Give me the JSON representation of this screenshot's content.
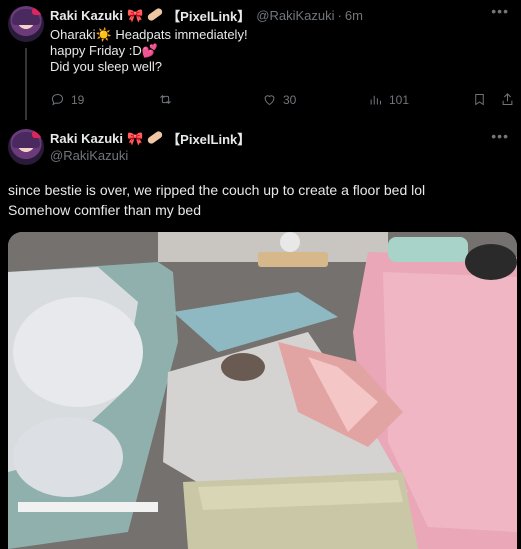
{
  "reply_tweet": {
    "display_name": "Raki Kazuki",
    "name_emojis": [
      "🎀",
      "🩹"
    ],
    "bracket_name": "【PixelLink】",
    "handle": "@RakiKazuki",
    "time": "6m",
    "lines": [
      "Oharaki",
      " Headpats immediately!",
      "happy Friday :D",
      "Did you sleep well?"
    ],
    "line1_emoji": "☀️",
    "line2_emoji": "💕",
    "actions": {
      "replies": "19",
      "reposts": "",
      "likes": "30",
      "views": "101"
    }
  },
  "main_tweet": {
    "display_name": "Raki Kazuki",
    "bracket_name": "【PixelLink】",
    "handle": "@RakiKazuki",
    "text_lines": [
      "since bestie is over, we ripped the couch up to create a floor bed lol",
      "Somehow comfier than my bed"
    ],
    "photo_alt": "Bedroom photo with a makeshift floor bed between two beds"
  },
  "colors": {
    "background": "#000000",
    "text": "#e7e9ea",
    "muted": "#71767b",
    "divider": "#2f3336",
    "accent": "#e0245e"
  }
}
